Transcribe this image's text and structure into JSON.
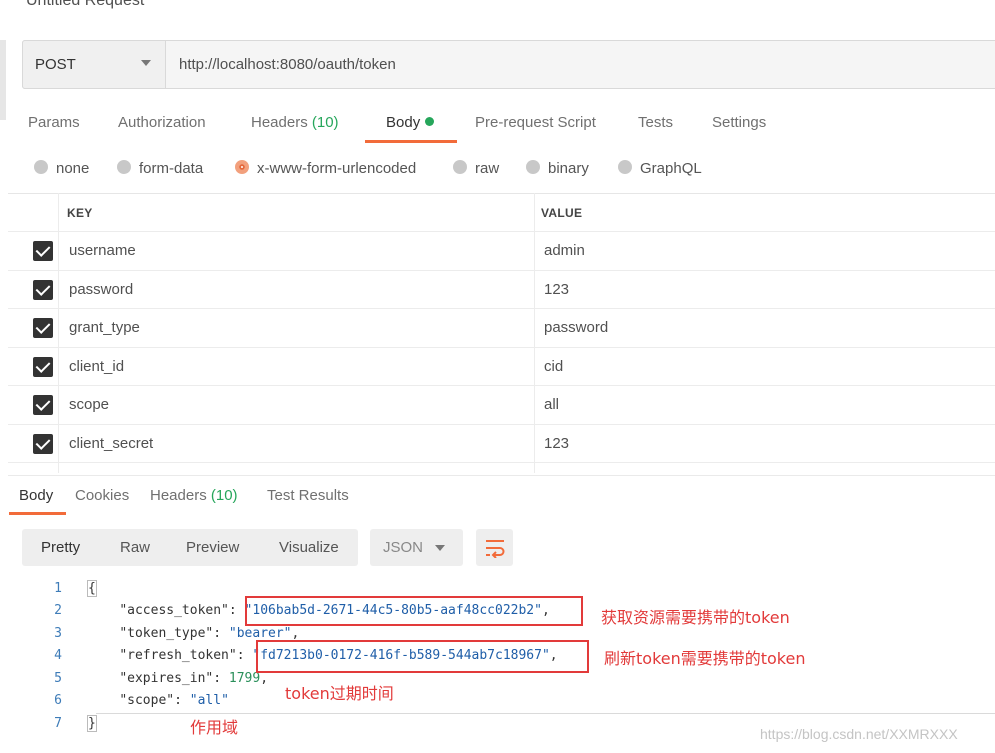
{
  "request": {
    "title": "Untitled Request",
    "method": "POST",
    "url": "http://localhost:8080/oauth/token",
    "tabs": [
      {
        "label": "Params",
        "count": ""
      },
      {
        "label": "Authorization",
        "count": ""
      },
      {
        "label": "Headers",
        "count": "(10)"
      },
      {
        "label": "Body",
        "count": ""
      },
      {
        "label": "Pre-request Script",
        "count": ""
      },
      {
        "label": "Tests",
        "count": ""
      },
      {
        "label": "Settings",
        "count": ""
      }
    ],
    "body_types": [
      "none",
      "form-data",
      "x-www-form-urlencoded",
      "raw",
      "binary",
      "GraphQL"
    ],
    "selected_body_type": "x-www-form-urlencoded",
    "table": {
      "headers": [
        "KEY",
        "VALUE"
      ],
      "rows": [
        {
          "key": "username",
          "value": "admin",
          "checked": true
        },
        {
          "key": "password",
          "value": "123",
          "checked": true
        },
        {
          "key": "grant_type",
          "value": "password",
          "checked": true
        },
        {
          "key": "client_id",
          "value": "cid",
          "checked": true
        },
        {
          "key": "scope",
          "value": "all",
          "checked": true
        },
        {
          "key": "client_secret",
          "value": "123",
          "checked": true
        }
      ]
    }
  },
  "response": {
    "tabs": [
      {
        "label": "Body",
        "count": ""
      },
      {
        "label": "Cookies",
        "count": ""
      },
      {
        "label": "Headers",
        "count": "(10)"
      },
      {
        "label": "Test Results",
        "count": ""
      }
    ],
    "formats": [
      "Pretty",
      "Raw",
      "Preview",
      "Visualize"
    ],
    "language": "JSON",
    "code_lines": [
      {
        "num": "1",
        "key": "",
        "value": "",
        "open": "{",
        "close": "",
        "value_type": "",
        "comma": ""
      },
      {
        "num": "2",
        "key": "\"access_token\"",
        "value": "\"106bab5d-2671-44c5-80b5-aaf48cc022b2\"",
        "open": "",
        "close": "",
        "value_type": "string",
        "comma": ","
      },
      {
        "num": "3",
        "key": "\"token_type\"",
        "value": "\"bearer\"",
        "open": "",
        "close": "",
        "value_type": "string",
        "comma": ","
      },
      {
        "num": "4",
        "key": "\"refresh_token\"",
        "value": "\"fd7213b0-0172-416f-b589-544ab7c18967\"",
        "open": "",
        "close": "",
        "value_type": "string",
        "comma": ","
      },
      {
        "num": "5",
        "key": "\"expires_in\"",
        "value": "1799",
        "open": "",
        "close": "",
        "value_type": "number",
        "comma": ","
      },
      {
        "num": "6",
        "key": "\"scope\"",
        "value": "\"all\"",
        "open": "",
        "close": "",
        "value_type": "string",
        "comma": ""
      },
      {
        "num": "7",
        "key": "",
        "value": "",
        "open": "",
        "close": "}",
        "value_type": "",
        "comma": ""
      }
    ]
  },
  "annotations": {
    "access_token_note": "获取资源需要携带的token",
    "refresh_token_note": "刷新token需要携带的token",
    "expires_note": "token过期时间",
    "scope_note": "作用域",
    "color": "#e23a3a"
  },
  "watermark": "https://blog.csdn.net/XXMRXXX",
  "colors": {
    "accent": "#f26b3a",
    "count_green": "#26a65b",
    "annotation_red": "#e23a3a"
  }
}
